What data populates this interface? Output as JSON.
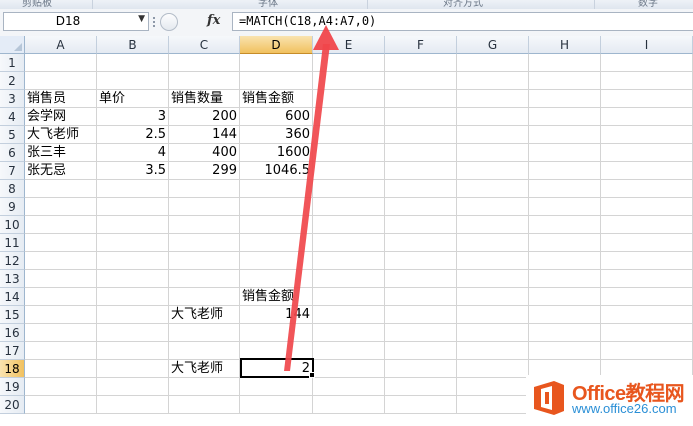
{
  "ribbon": {
    "groups": [
      "剪贴板",
      "字体",
      "对齐方式",
      "数字"
    ]
  },
  "formula_bar": {
    "name_box": "D18",
    "fx_label": "fx",
    "formula": "=MATCH(C18,A4:A7,0)"
  },
  "columns": [
    "A",
    "B",
    "C",
    "D",
    "E",
    "F",
    "G",
    "H",
    "I"
  ],
  "rows": [
    "1",
    "2",
    "3",
    "4",
    "5",
    "6",
    "7",
    "8",
    "9",
    "10",
    "11",
    "12",
    "13",
    "14",
    "15",
    "16",
    "17",
    "18",
    "19",
    "20"
  ],
  "active_cell": {
    "column": "D",
    "row": "18"
  },
  "cells": {
    "A3": "销售员",
    "B3": "单价",
    "C3": "销售数量",
    "D3": "销售金额",
    "A4": "会学网",
    "B4": "3",
    "C4": "200",
    "D4": "600",
    "A5": "大飞老师",
    "B5": "2.5",
    "C5": "144",
    "D5": "360",
    "A6": "张三丰",
    "B6": "4",
    "C6": "400",
    "D6": "1600",
    "A7": "张无忌",
    "B7": "3.5",
    "C7": "299",
    "D7": "1046.5",
    "D14": "销售金额",
    "C15": "大飞老师",
    "D15": "144",
    "C18": "大飞老师",
    "D18": "2"
  },
  "watermark": {
    "brand": "Office教程网",
    "url": "www.office26.com"
  },
  "colors": {
    "arrow": "#f0464b",
    "header_active": "#f1c15f",
    "brand_orange": "#e8561e",
    "brand_blue": "#2a8fd6"
  }
}
